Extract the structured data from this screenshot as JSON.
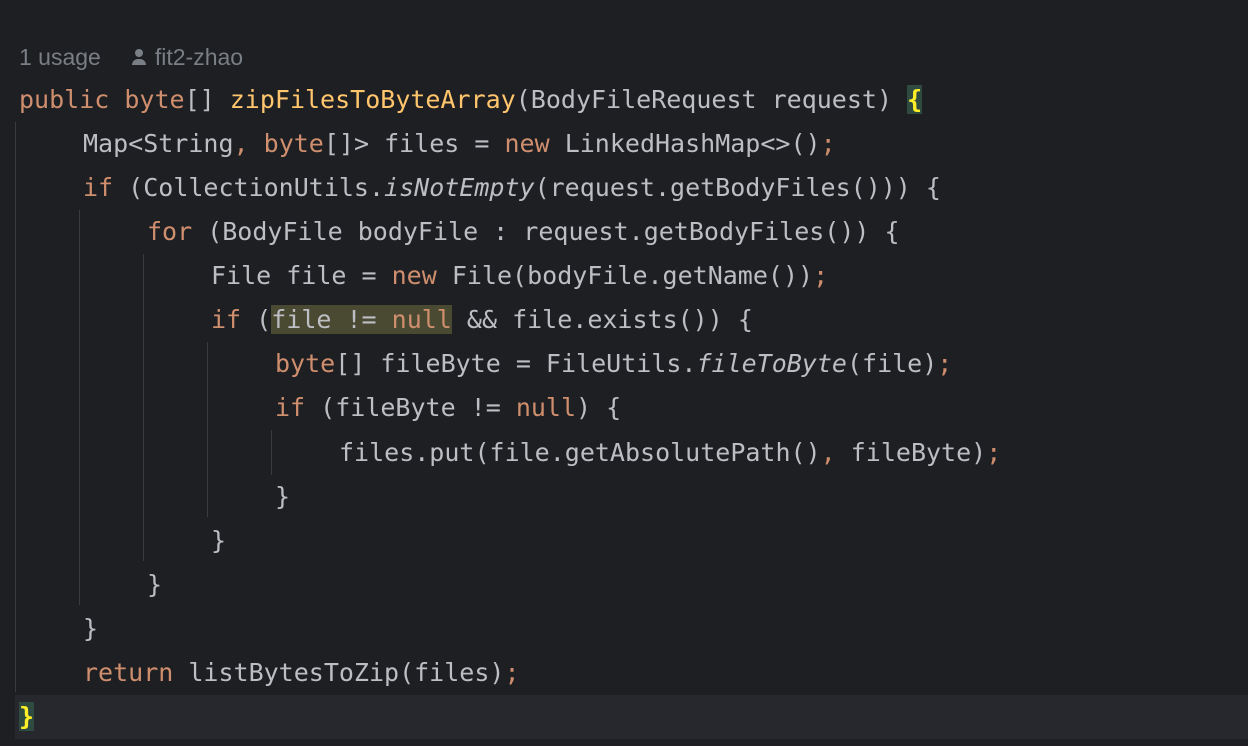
{
  "inlay_hints": {
    "usages": "1 usage",
    "author_icon": "person-icon",
    "author": "fit2-zhao"
  },
  "code": {
    "l1": {
      "kw1": "public",
      "kw2": "byte",
      "t1": "[] ",
      "name": "zipFilesToByteArray",
      "t2": "(BodyFileRequest request) ",
      "brace": "{"
    },
    "l2": {
      "t1": "Map<String",
      "comma": ",",
      "kw": "byte",
      "t2": "[]> files = ",
      "kw2": "new",
      "t3": " LinkedHashMap<>()",
      "semi": ";"
    },
    "l3": {
      "kw": "if",
      "t1": " (CollectionUtils.",
      "method": "isNotEmpty",
      "t2": "(request.getBodyFiles())) {"
    },
    "l4": {
      "kw": "for",
      "t1": " (BodyFile bodyFile : request.getBodyFiles()) {"
    },
    "l5": {
      "t1": "File file = ",
      "kw": "new",
      "t2": " File(bodyFile.getName())",
      "semi": ";"
    },
    "l6": {
      "kw": "if",
      "t1": " (",
      "hl1": "file != ",
      "hl2": "null",
      "t2": " && file.exists()) {"
    },
    "l7": {
      "kw": "byte",
      "t1": "[] fileByte = FileUtils.",
      "method": "fileToByte",
      "t2": "(file)",
      "semi": ";"
    },
    "l8": {
      "kw": "if",
      "t1": " (fileByte != ",
      "kw2": "null",
      "t2": ") {"
    },
    "l9": {
      "t1": "files.put(file.getAbsolutePath()",
      "comma": ",",
      "t2": " fileByte)",
      "semi": ";"
    },
    "l10": "}",
    "l11": "}",
    "l12": "}",
    "l13": "}",
    "l14": {
      "kw": "return",
      "t1": " listBytesToZip(files)",
      "semi": ";"
    },
    "l15": {
      "brace": "}"
    }
  }
}
